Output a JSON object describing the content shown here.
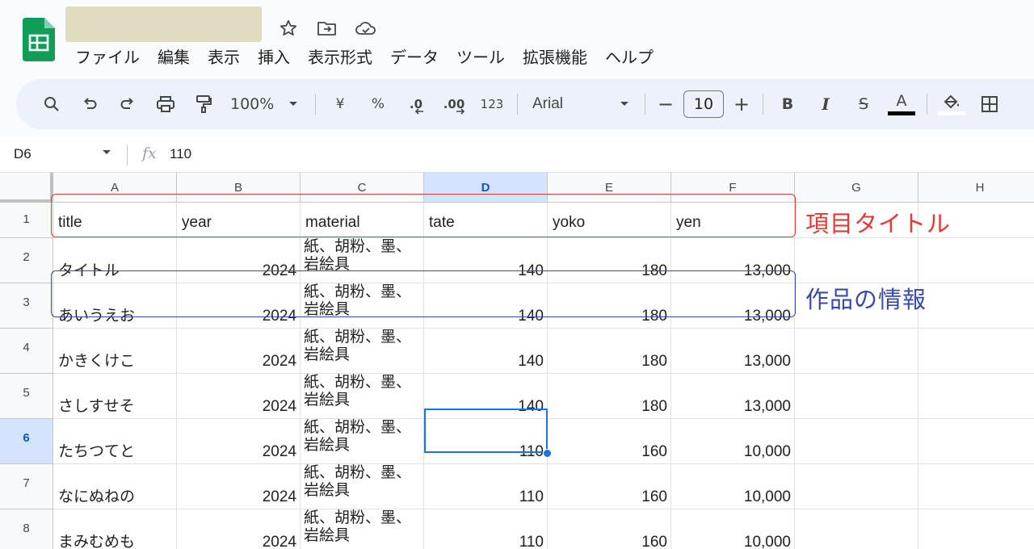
{
  "app": {
    "title_icons": [
      "star-icon",
      "move-to-folder-icon",
      "cloud-status-icon"
    ]
  },
  "menu": [
    "ファイル",
    "編集",
    "表示",
    "挿入",
    "表示形式",
    "データ",
    "ツール",
    "拡張機能",
    "ヘルプ"
  ],
  "toolbar": {
    "zoom": "100%",
    "currency": "¥",
    "percent": "%",
    "dec_decrease": ".0",
    "dec_increase": ".00",
    "number_format": "123",
    "font": "Arial",
    "font_size": "10",
    "minus": "−",
    "plus": "+",
    "bold": "B",
    "italic": "I",
    "strike": "S",
    "text_color": "A"
  },
  "formula_bar": {
    "cell_ref": "D6",
    "fx": "fx",
    "value": "110"
  },
  "columns": [
    "A",
    "B",
    "C",
    "D",
    "E",
    "F",
    "G",
    "H"
  ],
  "rows": [
    "1",
    "2",
    "3",
    "4",
    "5",
    "6",
    "7",
    "8"
  ],
  "header": {
    "title": "title",
    "year": "year",
    "material": "material",
    "tate": "tate",
    "yoko": "yoko",
    "yen": "yen"
  },
  "data_rows": [
    {
      "title": "タイトル",
      "year": "2024",
      "material_1": "紙、胡粉、墨、",
      "material_2": "岩絵具",
      "tate": "140",
      "yoko": "180",
      "yen": "13,000"
    },
    {
      "title": "あいうえお",
      "year": "2024",
      "material_1": "紙、胡粉、墨、",
      "material_2": "岩絵具",
      "tate": "140",
      "yoko": "180",
      "yen": "13,000"
    },
    {
      "title": "かきくけこ",
      "year": "2024",
      "material_1": "紙、胡粉、墨、",
      "material_2": "岩絵具",
      "tate": "140",
      "yoko": "180",
      "yen": "13,000"
    },
    {
      "title": "さしすせそ",
      "year": "2024",
      "material_1": "紙、胡粉、墨、",
      "material_2": "岩絵具",
      "tate": "140",
      "yoko": "180",
      "yen": "13,000"
    },
    {
      "title": "たちつてと",
      "year": "2024",
      "material_1": "紙、胡粉、墨、",
      "material_2": "岩絵具",
      "tate": "110",
      "yoko": "160",
      "yen": "10,000"
    },
    {
      "title": "なにぬねの",
      "year": "2024",
      "material_1": "紙、胡粉、墨、",
      "material_2": "岩絵具",
      "tate": "110",
      "yoko": "160",
      "yen": "10,000"
    },
    {
      "title": "まみむめも",
      "year": "2024",
      "material_1": "紙、胡粉、墨、",
      "material_2": "岩絵具",
      "tate": "110",
      "yoko": "160",
      "yen": "10,000"
    }
  ],
  "annotations": {
    "header_label": "項目タイトル",
    "row_label": "作品の情報"
  },
  "selection": {
    "cell": "D6",
    "column": "D",
    "row": "6"
  },
  "colors": {
    "annotation_red": "#e53935",
    "annotation_blue": "#3949ab",
    "selection": "#1a73e8",
    "selected_header": "#d3e3fd"
  }
}
